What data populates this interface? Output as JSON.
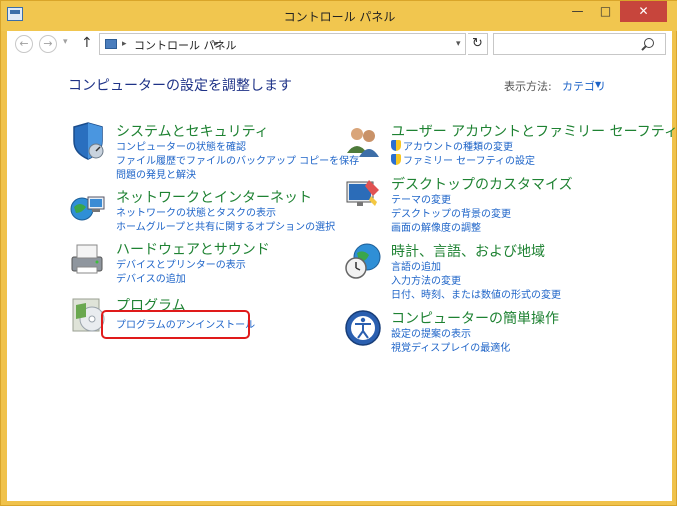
{
  "window": {
    "title": "コントロール パネル",
    "min_label": "—",
    "max_label": "□",
    "close_label": "✕"
  },
  "addressbar": {
    "breadcrumb": "コントロール パネル",
    "search_placeholder": ""
  },
  "heading": "コンピューターの設定を調整します",
  "viewby": {
    "label": "表示方法:",
    "value": "カテゴリ"
  },
  "categories": {
    "system": {
      "title": "システムとセキュリティ",
      "links": [
        "コンピューターの状態を確認",
        "ファイル履歴でファイルのバックアップ コピーを保存",
        "問題の発見と解決"
      ]
    },
    "network": {
      "title": "ネットワークとインターネット",
      "links": [
        "ネットワークの状態とタスクの表示",
        "ホームグループと共有に関するオプションの選択"
      ]
    },
    "hardware": {
      "title": "ハードウェアとサウンド",
      "links": [
        "デバイスとプリンターの表示",
        "デバイスの追加"
      ]
    },
    "programs": {
      "title": "プログラム",
      "links": [
        "プログラムのアンインストール"
      ]
    },
    "users": {
      "title": "ユーザー アカウントとファミリー セーフティ",
      "links": [
        "アカウントの種類の変更",
        "ファミリー セーフティの設定"
      ]
    },
    "appearance": {
      "title": "デスクトップのカスタマイズ",
      "links": [
        "テーマの変更",
        "デスクトップの背景の変更",
        "画面の解像度の調整"
      ]
    },
    "clock": {
      "title": "時計、言語、および地域",
      "links": [
        "言語の追加",
        "入力方法の変更",
        "日付、時刻、または数値の形式の変更"
      ]
    },
    "ease": {
      "title": "コンピューターの簡単操作",
      "links": [
        "設定の提案の表示",
        "視覚ディスプレイの最適化"
      ]
    }
  },
  "colors": {
    "accent_titlebar": "#f1c64f",
    "link": "#1e64c8",
    "category_title": "#1e8232",
    "heading": "#1e3287",
    "highlight": "#e01a1a"
  }
}
